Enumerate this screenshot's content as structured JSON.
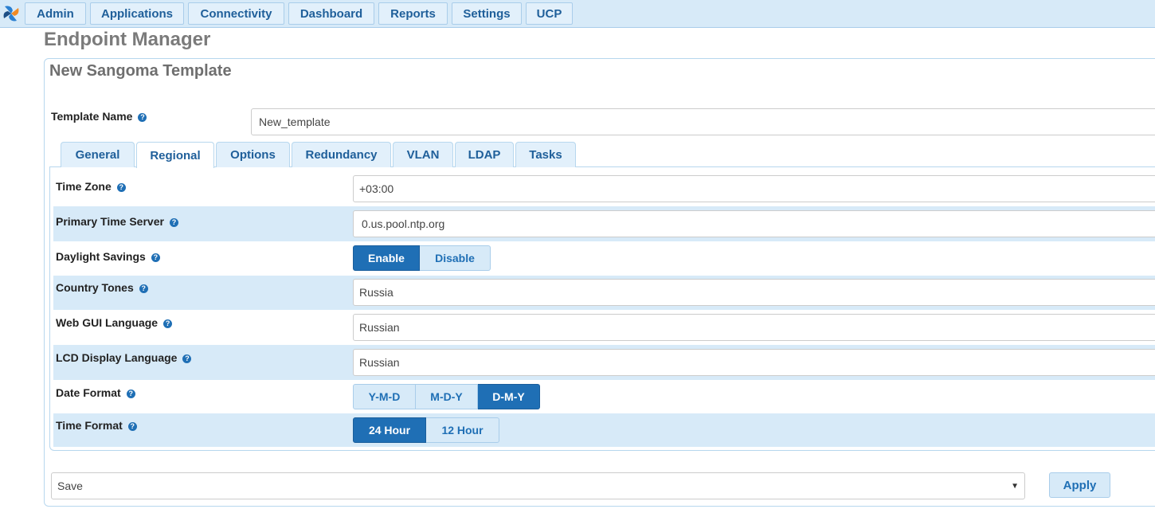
{
  "nav": {
    "items": [
      "Admin",
      "Applications",
      "Connectivity",
      "Dashboard",
      "Reports",
      "Settings",
      "UCP"
    ]
  },
  "page": {
    "title": "Endpoint Manager",
    "panel_title": "New Sangoma Template"
  },
  "template": {
    "label": "Template Name",
    "value": "New_template"
  },
  "tabs": [
    "General",
    "Regional",
    "Options",
    "Redundancy",
    "VLAN",
    "LDAP",
    "Tasks"
  ],
  "active_tab": "Regional",
  "regional": {
    "time_zone": {
      "label": "Time Zone",
      "value": "+03:00"
    },
    "primary_time_server": {
      "label": "Primary Time Server",
      "value": "0.us.pool.ntp.org"
    },
    "daylight_savings": {
      "label": "Daylight Savings",
      "options": [
        "Enable",
        "Disable"
      ],
      "selected": "Enable"
    },
    "country_tones": {
      "label": "Country Tones",
      "value": "Russia"
    },
    "web_gui_language": {
      "label": "Web GUI Language",
      "value": "Russian"
    },
    "lcd_display_language": {
      "label": "LCD Display Language",
      "value": "Russian"
    },
    "date_format": {
      "label": "Date Format",
      "options": [
        "Y-M-D",
        "M-D-Y",
        "D-M-Y"
      ],
      "selected": "D-M-Y"
    },
    "time_format": {
      "label": "Time Format",
      "options": [
        "24 Hour",
        "12 Hour"
      ],
      "selected": "24 Hour"
    }
  },
  "footer": {
    "action_select": "Save",
    "apply_label": "Apply"
  },
  "icons": {
    "help": "question-circle-icon",
    "logo": "pinwheel-logo",
    "select": "caret-down-icon"
  },
  "colors": {
    "accent": "#1f6fb5",
    "nav_bg": "#d7eaf8",
    "row_alt": "#d7eaf8"
  }
}
